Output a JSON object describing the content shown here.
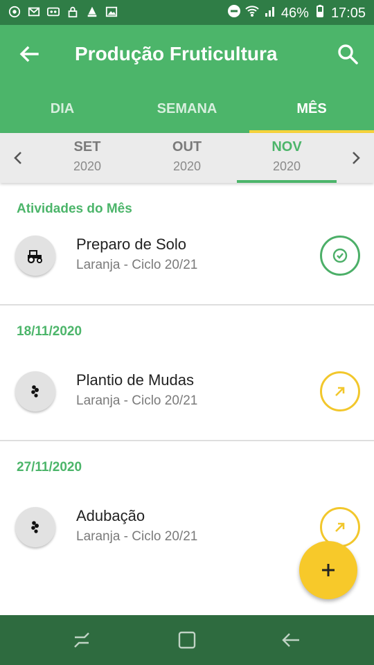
{
  "status_bar": {
    "battery": "46%",
    "time": "17:05",
    "left_icons": [
      "chrome-icon",
      "gmail-icon",
      "voicemail-icon",
      "lock-icon",
      "carrier-icon",
      "image-icon"
    ],
    "right_icons": [
      "dnd-icon",
      "wifi-icon",
      "signal-icon",
      "battery-icon"
    ]
  },
  "header": {
    "title": "Produção Fruticultura"
  },
  "tabs": [
    {
      "label": "DIA",
      "active": false
    },
    {
      "label": "SEMANA",
      "active": false
    },
    {
      "label": "MÊS",
      "active": true
    }
  ],
  "months": [
    {
      "name": "SET",
      "year": "2020",
      "active": false
    },
    {
      "name": "OUT",
      "year": "2020",
      "active": false
    },
    {
      "name": "NOV",
      "year": "2020",
      "active": true
    }
  ],
  "sections": [
    {
      "title": "Atividades do Mês",
      "activity": {
        "name": "Preparo de Solo",
        "subtitle": "Laranja - Ciclo 20/21",
        "icon": "tractor-icon",
        "status": "done",
        "status_color": "#4caf68"
      }
    },
    {
      "title": "18/11/2020",
      "activity": {
        "name": "Plantio de Mudas",
        "subtitle": "Laranja - Ciclo 20/21",
        "icon": "seeds-icon",
        "status": "open",
        "status_color": "#f2c72c"
      }
    },
    {
      "title": "27/11/2020",
      "activity": {
        "name": "Adubação",
        "subtitle": "Laranja - Ciclo 20/21",
        "icon": "seeds-icon",
        "status": "open",
        "status_color": "#f2c72c"
      }
    }
  ],
  "colors": {
    "primary": "#4cb56a",
    "primary_dark": "#2f7d46",
    "accent": "#f7c92a",
    "nav_bar": "#2e6b3f"
  }
}
